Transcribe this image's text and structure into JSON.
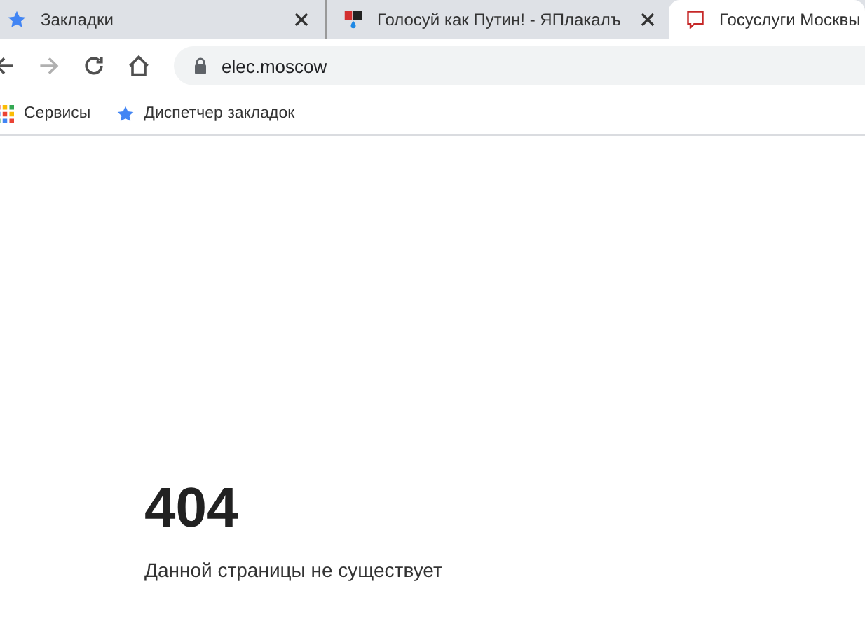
{
  "tabs": [
    {
      "title": "Закладки",
      "kind": "star",
      "selected": false,
      "closable": true
    },
    {
      "title": "Голосуй как Путин! - ЯПлакалъ",
      "kind": "logo",
      "selected": false,
      "closable": true
    },
    {
      "title": "Госуслуги Москвы",
      "kind": "speech",
      "selected": true,
      "closable": false
    }
  ],
  "nav_buttons": [
    {
      "kind": "back",
      "disabled": false
    },
    {
      "kind": "forward",
      "disabled": true
    },
    {
      "kind": "reload",
      "disabled": false
    },
    {
      "kind": "home",
      "disabled": false
    }
  ],
  "address_bar": {
    "secure": true,
    "url": "elec.moscow"
  },
  "bookmarks": [
    {
      "label": "Сервисы",
      "kind": "apps"
    },
    {
      "label": "Диспетчер закладок",
      "kind": "star"
    }
  ],
  "page": {
    "code": "404",
    "message": "Данной страницы не существует"
  }
}
